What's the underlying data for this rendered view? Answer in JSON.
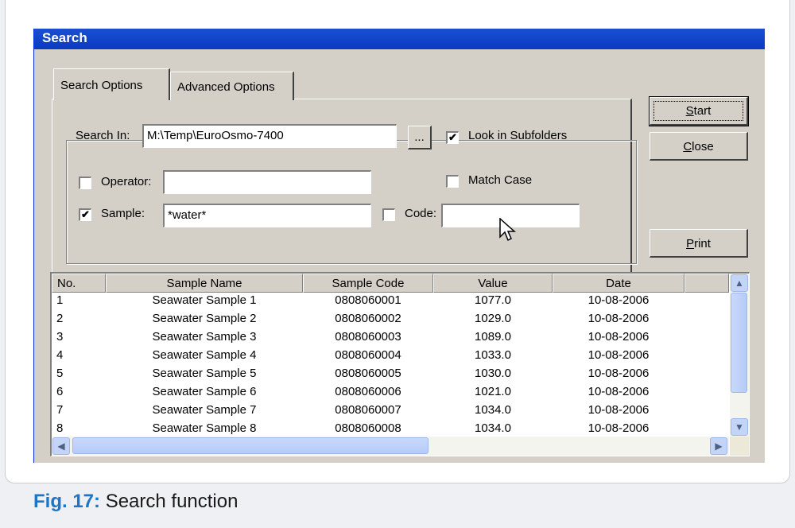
{
  "window": {
    "title": "Search"
  },
  "tabs": [
    {
      "label": "Search Options",
      "active": true
    },
    {
      "label": "Advanced Options",
      "active": false
    }
  ],
  "form": {
    "search_in_label": "Search In:",
    "search_in_value": "M:\\Temp\\EuroOsmo-7400",
    "browse_label": "...",
    "look_in_subfolders_label": "Look in Subfolders",
    "look_in_subfolders_checked": "✔",
    "operator_label": "Operator:",
    "operator_checked": "",
    "operator_value": "",
    "match_case_label": "Match Case",
    "match_case_checked": "",
    "sample_label": "Sample:",
    "sample_checked": "✔",
    "sample_value": "*water*",
    "code_label": "Code:",
    "code_checked": "",
    "code_value": ""
  },
  "buttons": {
    "start": {
      "mnemonic": "S",
      "rest": "tart"
    },
    "close": {
      "mnemonic": "C",
      "rest": "lose"
    },
    "print": {
      "mnemonic": "P",
      "rest": "rint"
    }
  },
  "table": {
    "columns": [
      "No.",
      "Sample Name",
      "Sample Code",
      "Value",
      "Date"
    ],
    "rows": [
      [
        "1",
        "Seawater Sample 1",
        "0808060001",
        "1077.0",
        "10-08-2006"
      ],
      [
        "2",
        "Seawater Sample 2",
        "0808060002",
        "1029.0",
        "10-08-2006"
      ],
      [
        "3",
        "Seawater Sample 3",
        "0808060003",
        "1089.0",
        "10-08-2006"
      ],
      [
        "4",
        "Seawater Sample 4",
        "0808060004",
        "1033.0",
        "10-08-2006"
      ],
      [
        "5",
        "Seawater Sample 5",
        "0808060005",
        "1030.0",
        "10-08-2006"
      ],
      [
        "6",
        "Seawater Sample 6",
        "0808060006",
        "1021.0",
        "10-08-2006"
      ],
      [
        "7",
        "Seawater Sample 7",
        "0808060007",
        "1034.0",
        "10-08-2006"
      ],
      [
        "8",
        "Seawater Sample 8",
        "0808060008",
        "1034.0",
        "10-08-2006"
      ]
    ]
  },
  "caption": {
    "number": "Fig. 17:",
    "text": "Search function"
  },
  "colors": {
    "title_bar": "#0a3ac0",
    "dialog": "#d4d0c8",
    "caption_accent": "#1d74c8"
  }
}
